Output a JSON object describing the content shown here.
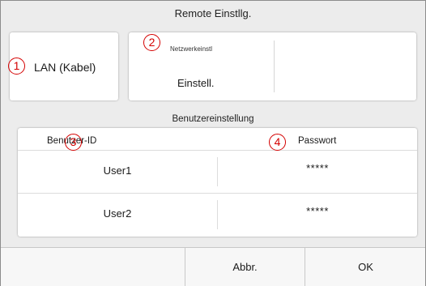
{
  "header": {
    "title": "Remote Einstllg."
  },
  "lan": {
    "label": "LAN (Kabel)",
    "marker": "1"
  },
  "network": {
    "small_label": "Netzwerkeinstl",
    "setting_label": "Einstell.",
    "marker": "2"
  },
  "users": {
    "section_title": "Benutzereinstellung",
    "columns": {
      "id": "Benutzer-ID",
      "password": "Passwort"
    },
    "id_marker": "3",
    "password_marker": "4",
    "rows": [
      {
        "user": "User1",
        "password": "*****"
      },
      {
        "user": "User2",
        "password": "*****"
      }
    ]
  },
  "footer": {
    "cancel_label": "Abbr.",
    "ok_label": "OK"
  },
  "colors": {
    "marker": "#d40000",
    "card": "#ffffff",
    "background": "#ececec"
  }
}
